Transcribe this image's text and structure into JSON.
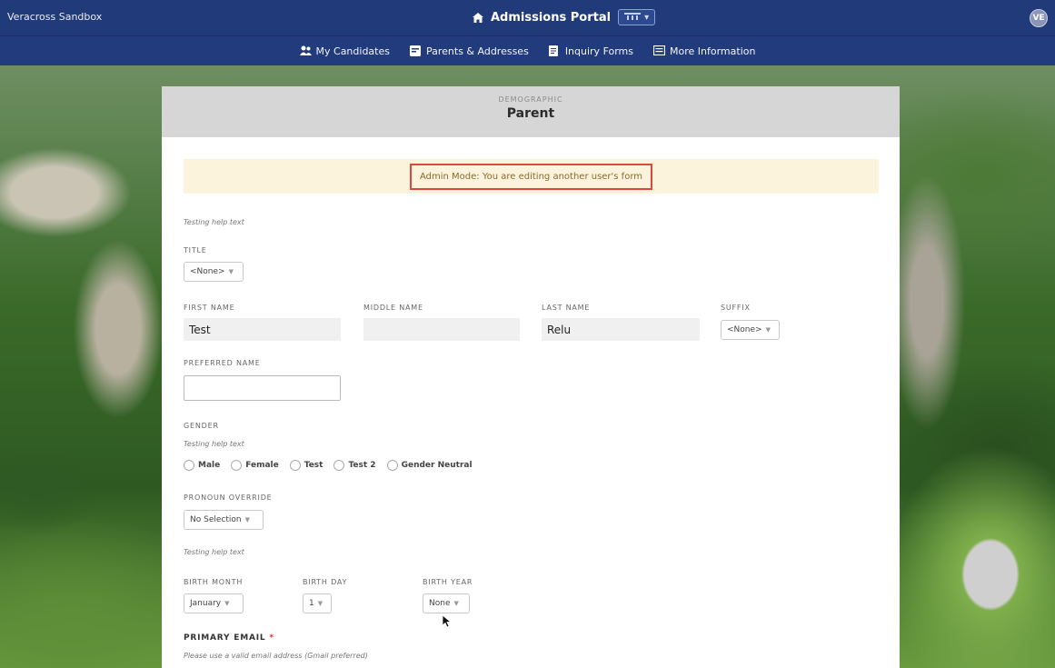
{
  "topbar": {
    "sandbox_label": "Veracross Sandbox",
    "portal_title": "Admissions Portal",
    "portal_menu_icon": "portal-switch-icon",
    "avatar_initials": "VE"
  },
  "nav": {
    "items": [
      {
        "label": "My Candidates",
        "icon": "people-icon"
      },
      {
        "label": "Parents & Addresses",
        "icon": "card-icon"
      },
      {
        "label": "Inquiry Forms",
        "icon": "document-icon"
      },
      {
        "label": "More Information",
        "icon": "info-box-icon"
      }
    ]
  },
  "form": {
    "section": "DEMOGRAPHIC",
    "title": "Parent",
    "admin_notice": "Admin Mode: You are editing another user's form",
    "help_top": "Testing help text",
    "title_field": {
      "label": "TITLE",
      "value": "<None>"
    },
    "first_name": {
      "label": "FIRST NAME",
      "value": "Test"
    },
    "middle_name": {
      "label": "MIDDLE NAME",
      "value": ""
    },
    "last_name": {
      "label": "LAST NAME",
      "value": "Relu"
    },
    "suffix": {
      "label": "SUFFIX",
      "value": "<None>"
    },
    "preferred_name": {
      "label": "PREFERRED NAME",
      "value": ""
    },
    "gender": {
      "label": "GENDER",
      "help": "Testing help text",
      "options": [
        "Male",
        "Female",
        "Test",
        "Test 2",
        "Gender Neutral"
      ]
    },
    "pronoun": {
      "label": "PRONOUN OVERRIDE",
      "value": "No Selection"
    },
    "help_birth": "Testing help text",
    "birth_month": {
      "label": "BIRTH MONTH",
      "value": "January"
    },
    "birth_day": {
      "label": "BIRTH DAY",
      "value": "1"
    },
    "birth_year": {
      "label": "BIRTH YEAR",
      "value": "None"
    },
    "primary_email": {
      "label": "PRIMARY EMAIL",
      "required_mark": "*",
      "help": "Please use a valid email address (Gmail preferred)"
    }
  },
  "colors": {
    "topbar": "#213a7a",
    "alert_bg": "#fbf3dc",
    "alert_border": "#e0463c"
  }
}
